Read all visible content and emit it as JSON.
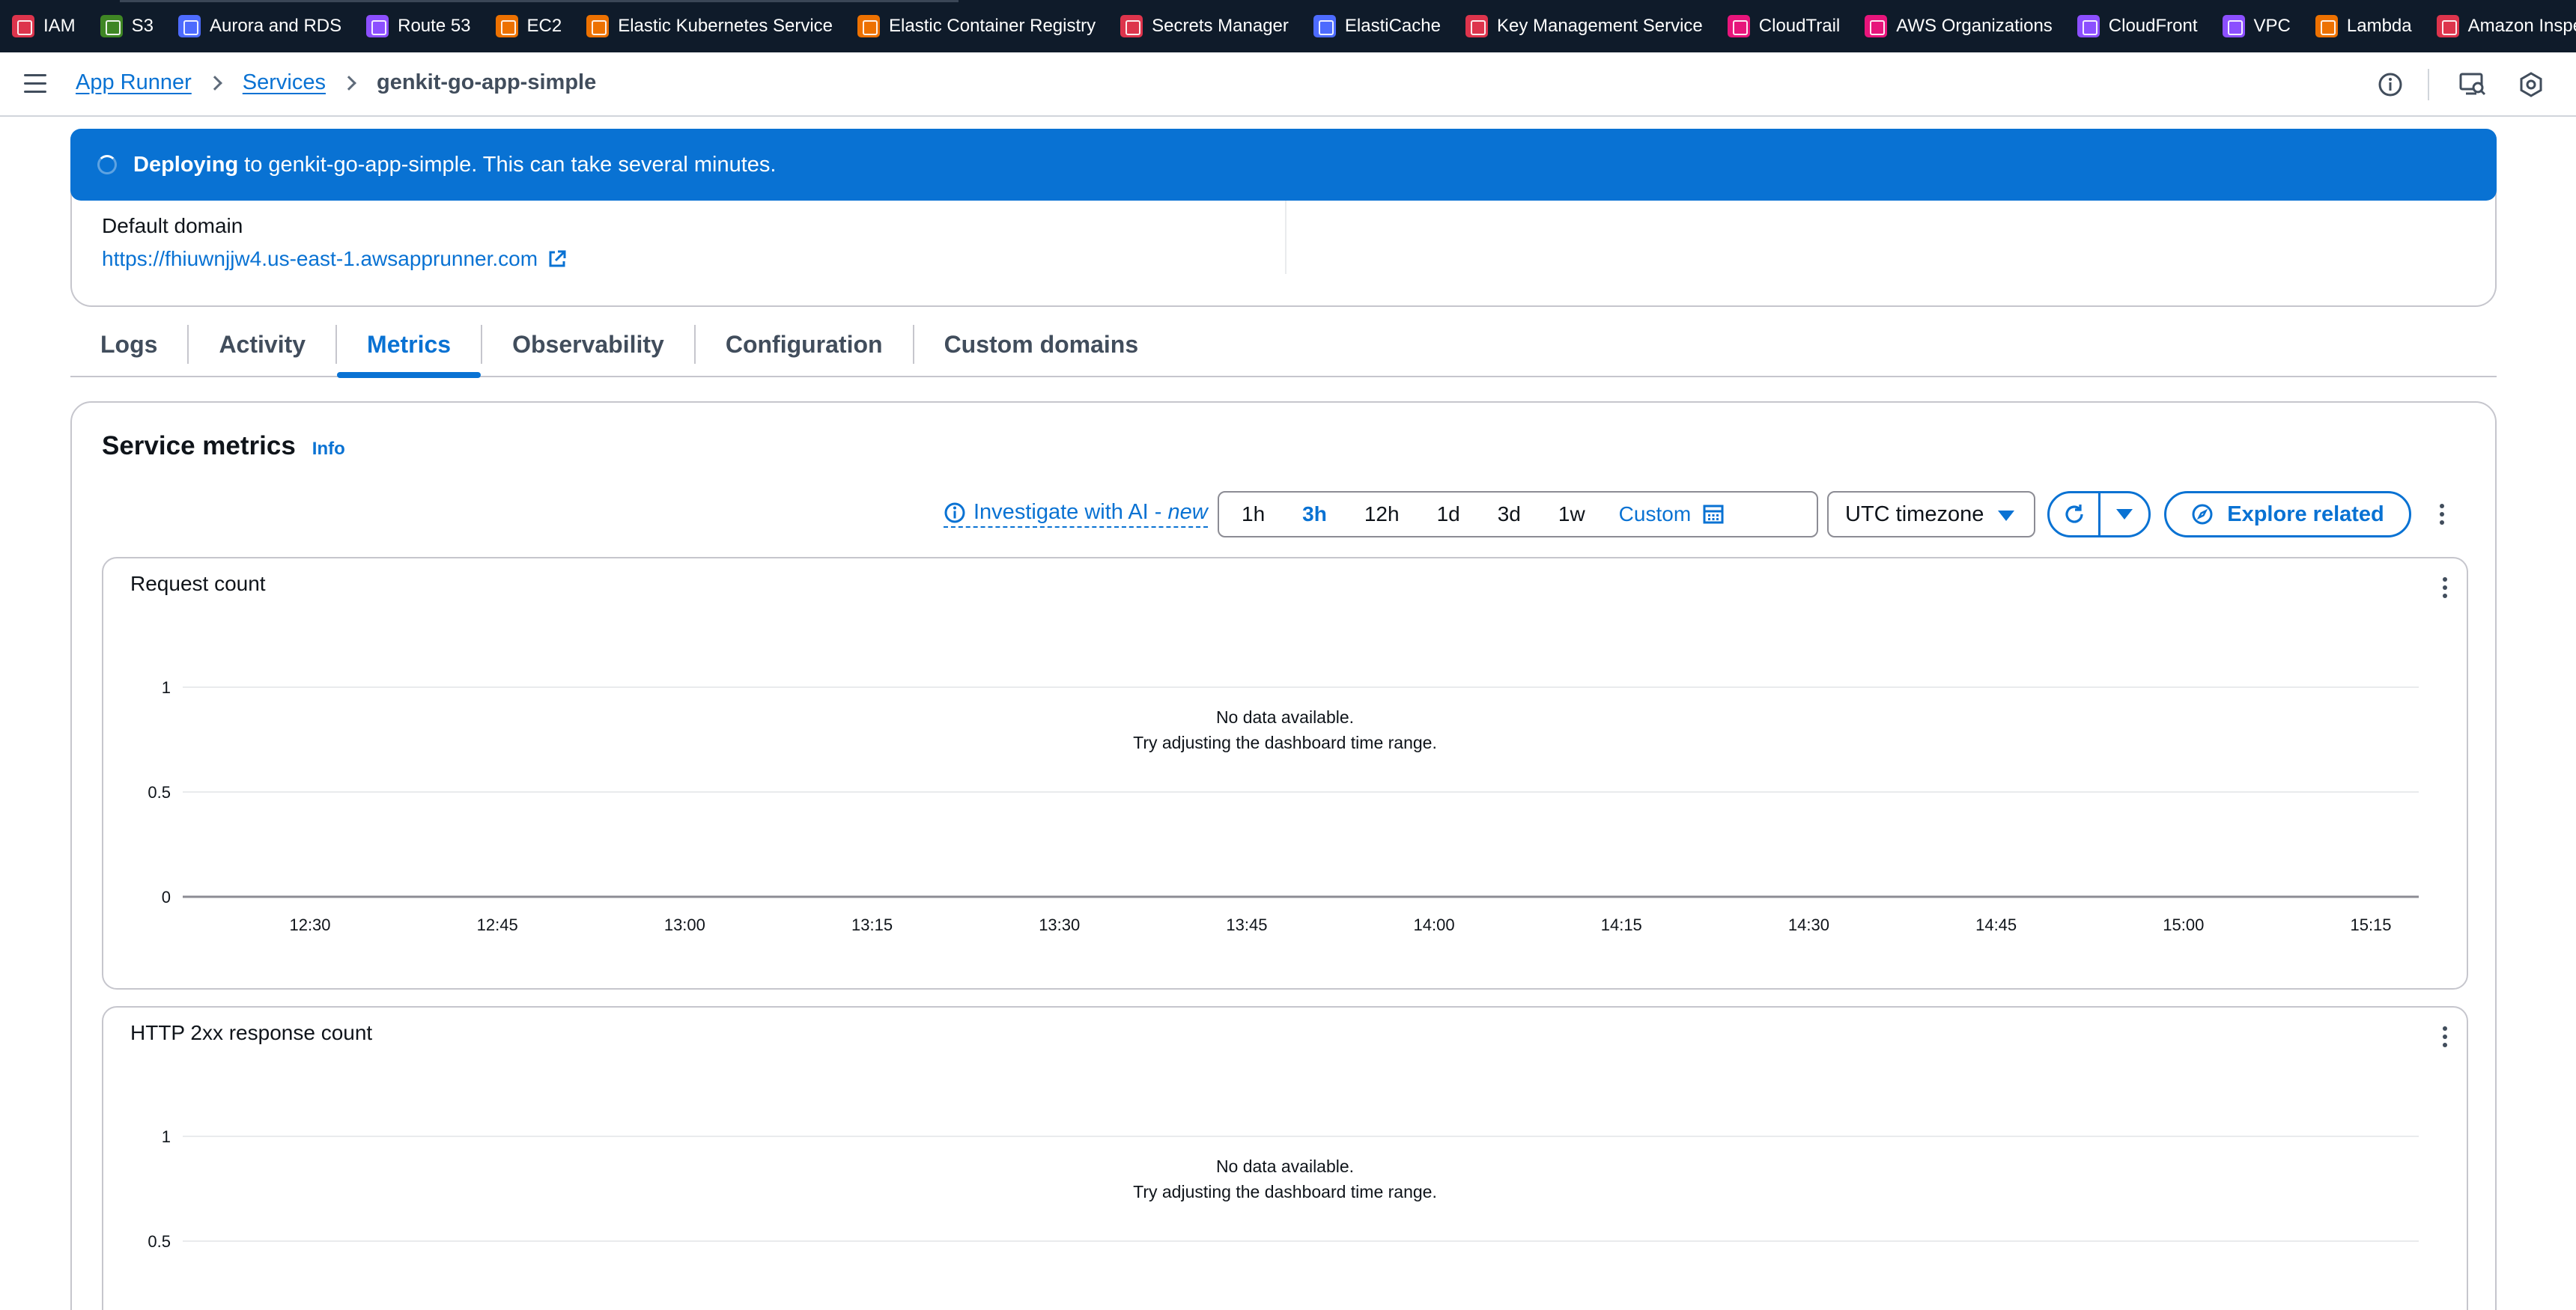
{
  "favorites": [
    {
      "label": "IAM",
      "color": "#dd344c"
    },
    {
      "label": "S3",
      "color": "#3f8624"
    },
    {
      "label": "Aurora and RDS",
      "color": "#4d6bfe"
    },
    {
      "label": "Route 53",
      "color": "#8c4fff"
    },
    {
      "label": "EC2",
      "color": "#ed7100"
    },
    {
      "label": "Elastic Kubernetes Service",
      "color": "#ed7100"
    },
    {
      "label": "Elastic Container Registry",
      "color": "#ed7100"
    },
    {
      "label": "Secrets Manager",
      "color": "#dd344c"
    },
    {
      "label": "ElastiCache",
      "color": "#4d6bfe"
    },
    {
      "label": "Key Management Service",
      "color": "#dd344c"
    },
    {
      "label": "CloudTrail",
      "color": "#e7157b"
    },
    {
      "label": "AWS Organizations",
      "color": "#e7157b"
    },
    {
      "label": "CloudFront",
      "color": "#8c4fff"
    },
    {
      "label": "VPC",
      "color": "#8c4fff"
    },
    {
      "label": "Lambda",
      "color": "#ed7100"
    },
    {
      "label": "Amazon Inspector",
      "color": "#dd344c"
    }
  ],
  "breadcrumb": {
    "root": "App Runner",
    "section": "Services",
    "current": "genkit-go-app-simple"
  },
  "flash": {
    "strong": "Deploying",
    "message": "to genkit-go-app-simple. This can take several minutes."
  },
  "summary": {
    "default_domain_label": "Default domain",
    "default_domain_url": "https://fhiuwnjjw4.us-east-1.awsapprunner.com"
  },
  "tabs": [
    {
      "label": "Logs"
    },
    {
      "label": "Activity"
    },
    {
      "label": "Metrics"
    },
    {
      "label": "Observability"
    },
    {
      "label": "Configuration"
    },
    {
      "label": "Custom domains"
    }
  ],
  "active_tab": "Metrics",
  "metrics": {
    "title": "Service metrics",
    "info": "Info",
    "investigate_label": "Investigate with AI - ",
    "investigate_new": "new",
    "ranges": [
      "1h",
      "3h",
      "12h",
      "1d",
      "3d",
      "1w"
    ],
    "active_range": "3h",
    "custom_label": "Custom",
    "timezone": "UTC timezone",
    "explore_label": "Explore related"
  },
  "colors": {
    "accent": "#0972d3",
    "gridline": "#e9ebed",
    "axis": "#8c8c94"
  },
  "chart_data": [
    {
      "type": "line",
      "title": "Request count",
      "x": [
        "12:30",
        "12:45",
        "13:00",
        "13:15",
        "13:30",
        "13:45",
        "14:00",
        "14:15",
        "14:30",
        "14:45",
        "15:00",
        "15:15"
      ],
      "y_ticks": [
        "1",
        "0.5",
        "0"
      ],
      "ylim": [
        0,
        1
      ],
      "series": [],
      "empty_message": "No data available.",
      "empty_hint": "Try adjusting the dashboard time range.",
      "grid": true
    },
    {
      "type": "line",
      "title": "HTTP 2xx response count",
      "x": [],
      "y_ticks": [
        "1",
        "0.5"
      ],
      "ylim": [
        0,
        1
      ],
      "series": [],
      "empty_message": "No data available.",
      "empty_hint": "Try adjusting the dashboard time range.",
      "grid": true
    }
  ]
}
